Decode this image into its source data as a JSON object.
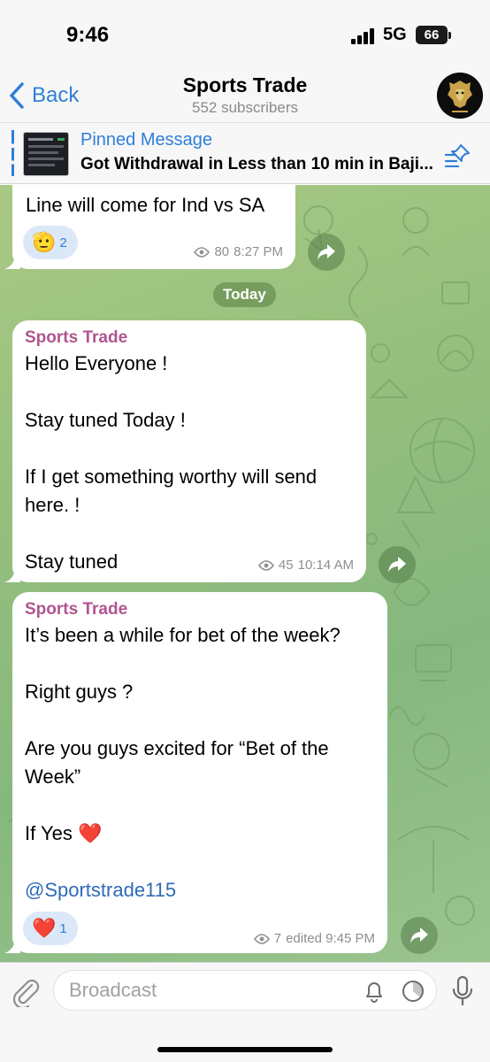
{
  "status_bar": {
    "time": "9:46",
    "network": "5G",
    "battery": "66"
  },
  "header": {
    "back_label": "Back",
    "title": "Sports Trade",
    "subtitle": "552 subscribers"
  },
  "pinned": {
    "title": "Pinned Message",
    "text": "Got Withdrawal in Less than 10 min in Baji..."
  },
  "chat": {
    "date_separator": "Today",
    "messages": [
      {
        "text": "Line will come for Ind vs SA",
        "reaction": {
          "emoji": "🫡",
          "count": "2"
        },
        "views": "80",
        "time": "8:27 PM"
      },
      {
        "sender": "Sports Trade",
        "text": "Hello Everyone !\n\nStay tuned Today !\n\nIf I get something worthy will send here. !\n\nStay tuned",
        "views": "45",
        "time": "10:14 AM"
      },
      {
        "sender": "Sports Trade",
        "text": "It’s been a while for bet of the week?\n\nRight guys ?\n\nAre you guys excited for “Bet of the Week”\n\nIf Yes ❤️",
        "mention": "@Sportstrade115",
        "reaction": {
          "emoji": "❤️",
          "count": "1"
        },
        "views": "7",
        "time": "edited 9:45 PM"
      }
    ]
  },
  "composer": {
    "placeholder": "Broadcast"
  },
  "colors": {
    "accent": "#2f7fd9",
    "sender": "#b0558f",
    "chat_bg": "#95bf7d"
  },
  "icons": [
    "back-chevron-icon",
    "pinned-list-icon",
    "eye-icon",
    "share-icon",
    "attach-icon",
    "bell-icon",
    "timer-icon",
    "mic-icon"
  ]
}
